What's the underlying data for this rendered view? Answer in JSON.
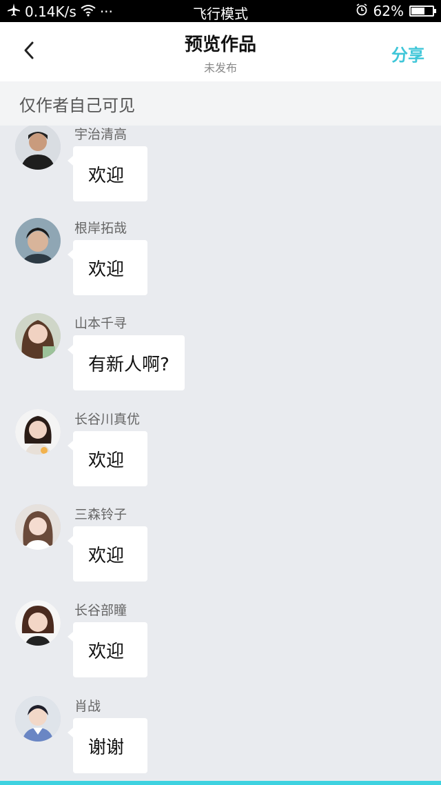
{
  "status_bar": {
    "speed": "0.14K/s",
    "dots": "···",
    "mode": "飞行模式",
    "battery": "62%",
    "battery_level": 0.62
  },
  "header": {
    "title": "预览作品",
    "subtitle": "未发布",
    "share_label": "分享"
  },
  "notice": "仅作者自己可见",
  "messages": [
    {
      "name": "宇治清高",
      "text": "欢迎"
    },
    {
      "name": "根岸拓哉",
      "text": "欢迎"
    },
    {
      "name": "山本千寻",
      "text": "有新人啊?"
    },
    {
      "name": "长谷川真优",
      "text": "欢迎"
    },
    {
      "name": "三森铃子",
      "text": "欢迎"
    },
    {
      "name": "长谷部瞳",
      "text": "欢迎"
    },
    {
      "name": "肖战",
      "text": "谢谢"
    }
  ],
  "colors": {
    "accent": "#3fc6d8",
    "background": "#e9ebef"
  }
}
